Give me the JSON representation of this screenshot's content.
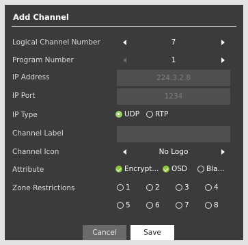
{
  "dialog": {
    "title": "Add Channel"
  },
  "logical_channel": {
    "label": "Logical Channel Number",
    "value": "7"
  },
  "program_number": {
    "label": "Program Number",
    "value": "1"
  },
  "ip_address": {
    "label": "IP Address",
    "value": "224.3.2.8"
  },
  "ip_port": {
    "label": "IP Port",
    "value": "1234"
  },
  "ip_type": {
    "label": "IP Type",
    "options": [
      {
        "label": "UDP",
        "selected": true
      },
      {
        "label": "RTP",
        "selected": false
      }
    ]
  },
  "channel_label": {
    "label": "Channel Label",
    "value": ""
  },
  "channel_icon": {
    "label": "Channel Icon",
    "value": "No Logo"
  },
  "attribute": {
    "label": "Attribute",
    "options": [
      {
        "label": "Encrypt...",
        "checked": true
      },
      {
        "label": "OSD",
        "checked": true
      },
      {
        "label": "Bla...",
        "checked": false
      }
    ]
  },
  "zone_restrictions": {
    "label": "Zone Restrictions",
    "zones": [
      "1",
      "2",
      "3",
      "4",
      "5",
      "6",
      "7",
      "8"
    ]
  },
  "buttons": {
    "cancel": "Cancel",
    "save": "Save"
  },
  "colors": {
    "dialog_bg": "#3b3b3b",
    "accent_green": "#8cc63f",
    "field_bg": "#4f4f4f"
  }
}
